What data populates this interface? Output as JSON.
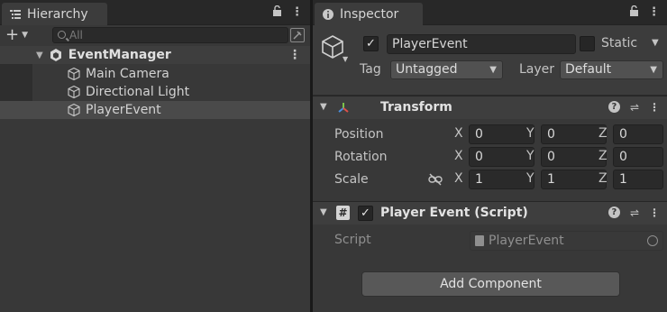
{
  "hierarchy": {
    "tab_title": "Hierarchy",
    "search_placeholder": "All",
    "scene_name": "EventManager",
    "items": [
      {
        "label": "Main Camera"
      },
      {
        "label": "Directional Light"
      },
      {
        "label": "PlayerEvent"
      }
    ]
  },
  "inspector": {
    "tab_title": "Inspector",
    "object_name": "PlayerEvent",
    "static_label": "Static",
    "tag_label": "Tag",
    "tag_value": "Untagged",
    "layer_label": "Layer",
    "layer_value": "Default",
    "transform": {
      "title": "Transform",
      "position_label": "Position",
      "rotation_label": "Rotation",
      "scale_label": "Scale",
      "axis_x": "X",
      "axis_y": "Y",
      "axis_z": "Z",
      "position": [
        "0",
        "0",
        "0"
      ],
      "rotation": [
        "0",
        "0",
        "0"
      ],
      "scale": [
        "1",
        "1",
        "1"
      ]
    },
    "script_component": {
      "title": "Player Event (Script)",
      "script_label": "Script",
      "script_value": "PlayerEvent"
    },
    "add_component_label": "Add Component"
  },
  "icons": [
    "hierarchy-icon",
    "info-icon",
    "lock-icon",
    "kebab-icon",
    "plus-icon",
    "search-icon",
    "picker-icon",
    "unity-scene-icon",
    "cube-icon",
    "transform-icon",
    "script-icon",
    "help-icon",
    "preset-icon",
    "link-icon"
  ],
  "colors": {
    "panel": "#383838",
    "field": "#2a2a2a",
    "selected_row": "#4a4a4a"
  }
}
